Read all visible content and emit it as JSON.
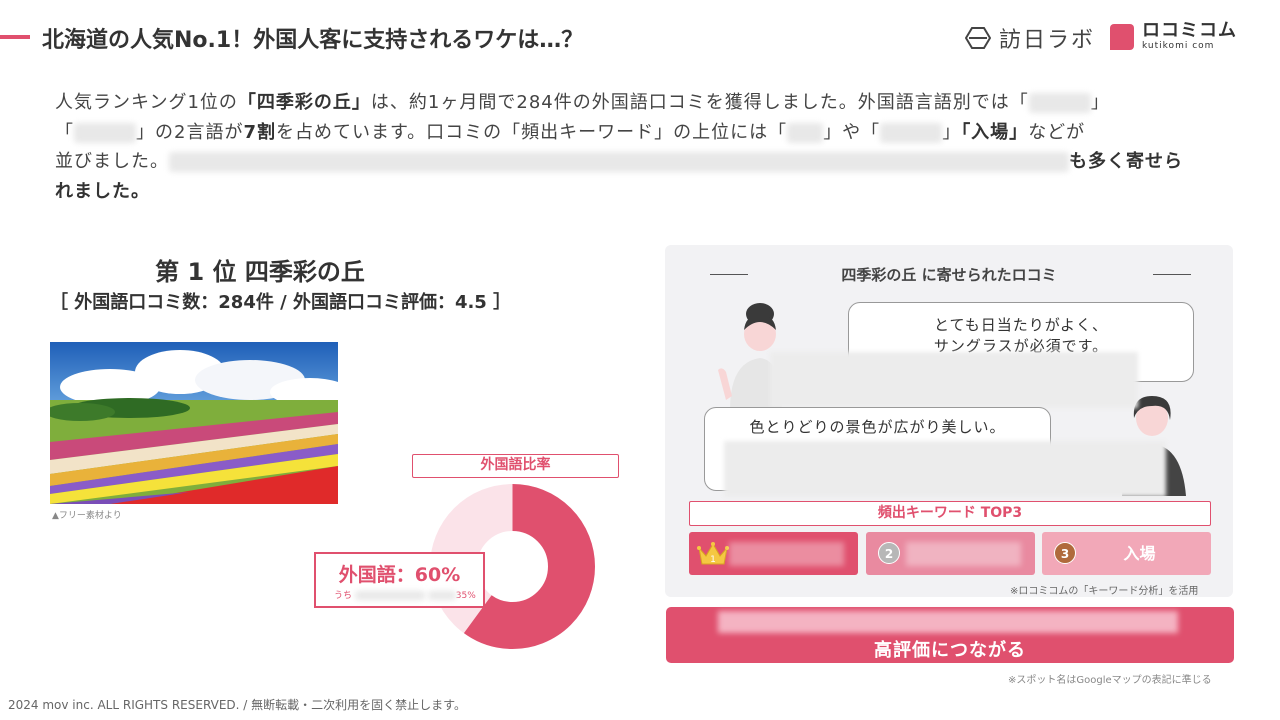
{
  "header": {
    "title": "北海道の人気No.1！外国人客に支持されるワケは…？",
    "logo_hojin": "訪日ラボ",
    "logo_kutikomi": "ロコミコム",
    "logo_kutikomi_sub": "kutikomi com"
  },
  "intro": {
    "p1": "人気ランキング1位の",
    "p1_bold": "「四季彩の丘」",
    "p2": "は、約1ヶ月間で284件の外国語口コミを獲得しました。外国語言語別では「",
    "p3": "」",
    "p4": "「",
    "p5": "」の2言語が",
    "p5_bold": "7割",
    "p6": "を占めています。口コミの「頻出キーワード」の上位には「",
    "p7": "」や「",
    "p8": "」",
    "p8_bold": "「入場」",
    "p9": "などが",
    "p10": "並びました。",
    "p11_bold": "も多く寄せら",
    "p12_bold": "れました。"
  },
  "ranking": {
    "title": "第 1 位 四季彩の丘",
    "subtitle": "［ 外国語口コミ数：284件 / 外国語口コミ評価：4.5 ］",
    "photo_credit": "▲フリー素材より"
  },
  "ratio": {
    "label": "外国語比率",
    "main": "外国語：60%",
    "sub_prefix": "うち",
    "sub_suffix": "35%",
    "value": 60
  },
  "reviews": {
    "title": "四季彩の丘 に寄せられたロコミ",
    "bubble1_line1": "とても日当たりがよく、",
    "bubble1_line2": "サングラスが必須です。",
    "bubble2_line1": "色とりどりの景色が広がり美しい。"
  },
  "keywords": {
    "title": "頻出キーワード TOP3",
    "items": [
      {
        "rank": "1",
        "word": ""
      },
      {
        "rank": "2",
        "word": ""
      },
      {
        "rank": "3",
        "word": "入場"
      }
    ],
    "note": "※ロコミコムの「キーワード分析」を活用"
  },
  "cta": {
    "label": "高評価につながる",
    "note": "※スポット名はGoogleマップの表記に準じる"
  },
  "footer": {
    "copyright": "2024 mov inc. ALL RIGHTS RESERVED. / 無断転載・二次利用を固く禁止します。"
  },
  "colors": {
    "accent": "#e0506e",
    "panel": "#f2f2f4"
  }
}
